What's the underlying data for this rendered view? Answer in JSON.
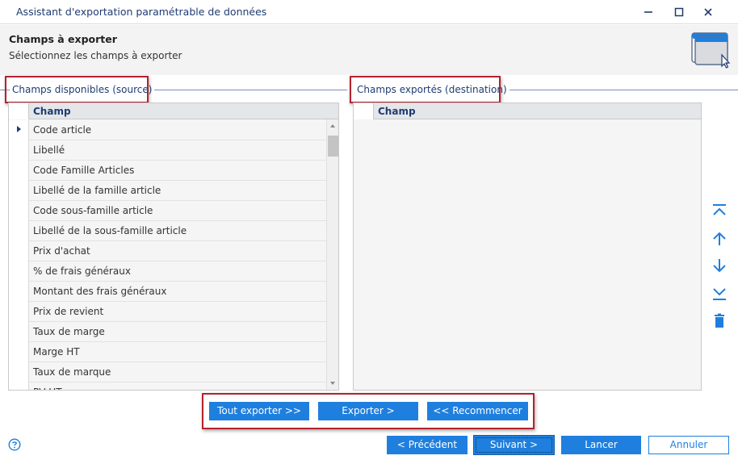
{
  "window": {
    "title": "Assistant d'exportation paramétrable de données"
  },
  "header": {
    "title": "Champs à exporter",
    "subtitle": "Sélectionnez les champs à exporter"
  },
  "source": {
    "group_label": "Champs disponibles (source)",
    "column_header": "Champ",
    "rows": [
      "Code article",
      "Libellé",
      "Code Famille Articles",
      "Libellé de la famille article",
      "Code sous-famille article",
      "Libellé de la sous-famille article",
      "Prix d'achat",
      "% de frais généraux",
      "Montant des frais généraux",
      "Prix de revient",
      "Taux de marge",
      "Marge HT",
      "Taux de marque",
      "PV HT"
    ]
  },
  "destination": {
    "group_label": "Champs exportés (destination)",
    "column_header": "Champ",
    "rows": []
  },
  "actions": {
    "export_all": "Tout exporter >>",
    "export": "Exporter >",
    "reset": "<< Recommencer"
  },
  "footer": {
    "previous": "< Précédent",
    "next": "Suivant >",
    "launch": "Lancer",
    "cancel": "Annuler"
  },
  "icons": {
    "minimize": "minimize-icon",
    "maximize": "maximize-icon",
    "close": "close-icon",
    "wizard": "window-cursor-icon",
    "move_top": "move-top-icon",
    "move_up": "arrow-up-icon",
    "move_down": "arrow-down-icon",
    "move_bottom": "move-bottom-icon",
    "delete": "trash-icon",
    "help": "help-icon"
  },
  "colors": {
    "accent": "#1f7fde",
    "title": "#1f3b73",
    "highlight_box": "#b1232d"
  }
}
